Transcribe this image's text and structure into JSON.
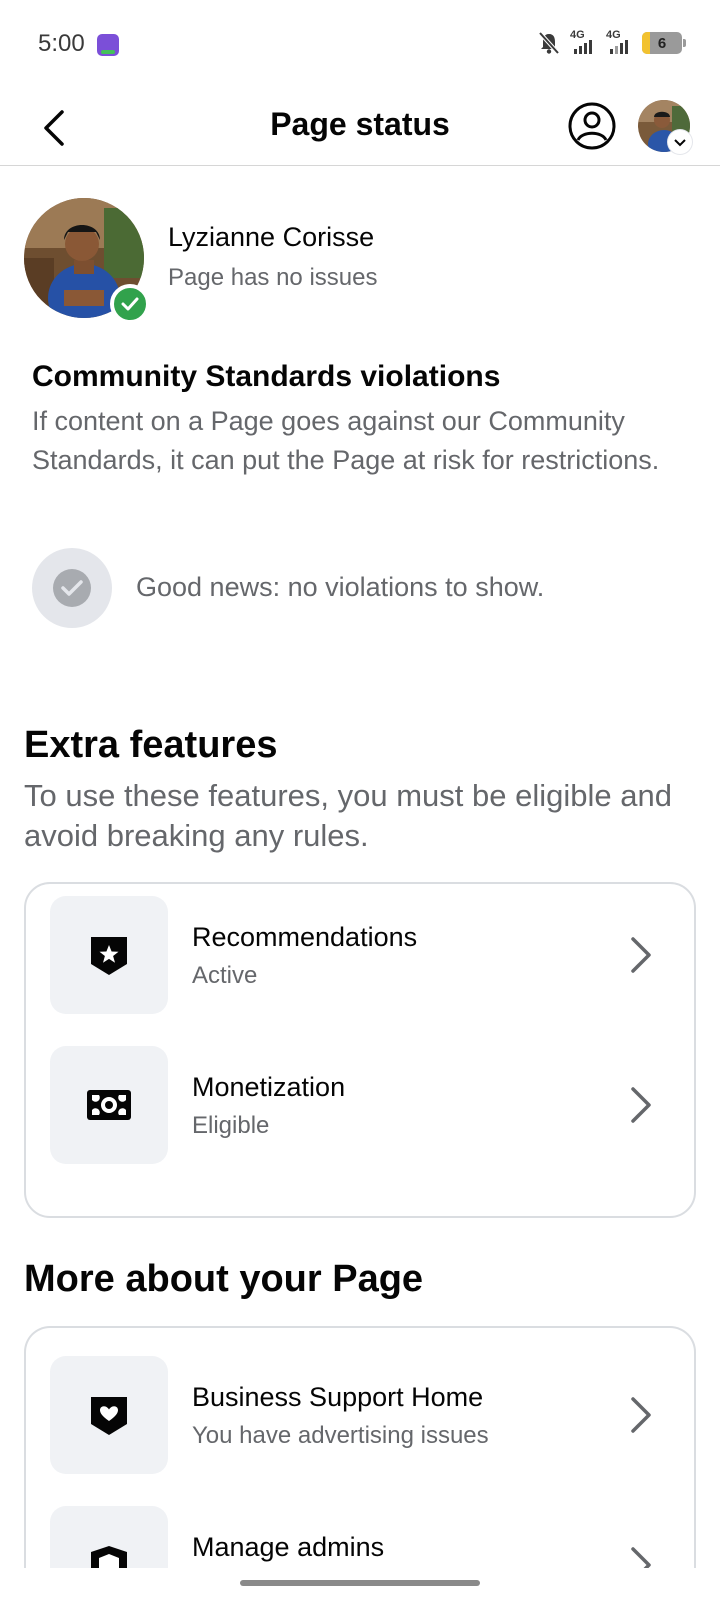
{
  "status_bar": {
    "time": "5:00",
    "network_1": "4G",
    "network_2": "4G",
    "battery_level": "6"
  },
  "header": {
    "title": "Page status"
  },
  "page": {
    "name": "Lyzianne Corisse",
    "status": "Page has no issues"
  },
  "community_standards": {
    "title": "Community Standards violations",
    "description": "If content on a Page goes against our Community Standards, it can put the Page at risk for restrictions.",
    "status_text": "Good news: no violations to show."
  },
  "extra_features": {
    "title": "Extra features",
    "description": "To use these features, you must be eligible and avoid breaking any rules.",
    "items": [
      {
        "title": "Recommendations",
        "subtitle": "Active",
        "icon": "star-badge-icon"
      },
      {
        "title": "Monetization",
        "subtitle": "Eligible",
        "icon": "money-icon"
      }
    ]
  },
  "more_about": {
    "title": "More about your Page",
    "items": [
      {
        "title": "Business Support Home",
        "subtitle": "You have advertising issues",
        "icon": "heart-shield-icon"
      },
      {
        "title": "Manage admins",
        "subtitle": "",
        "icon": "shield-icon"
      }
    ]
  },
  "colors": {
    "primary_text": "#050505",
    "secondary_text": "#65676b",
    "verified_green": "#31a24c",
    "card_border": "#dadde1",
    "icon_bg": "#f0f2f5"
  }
}
